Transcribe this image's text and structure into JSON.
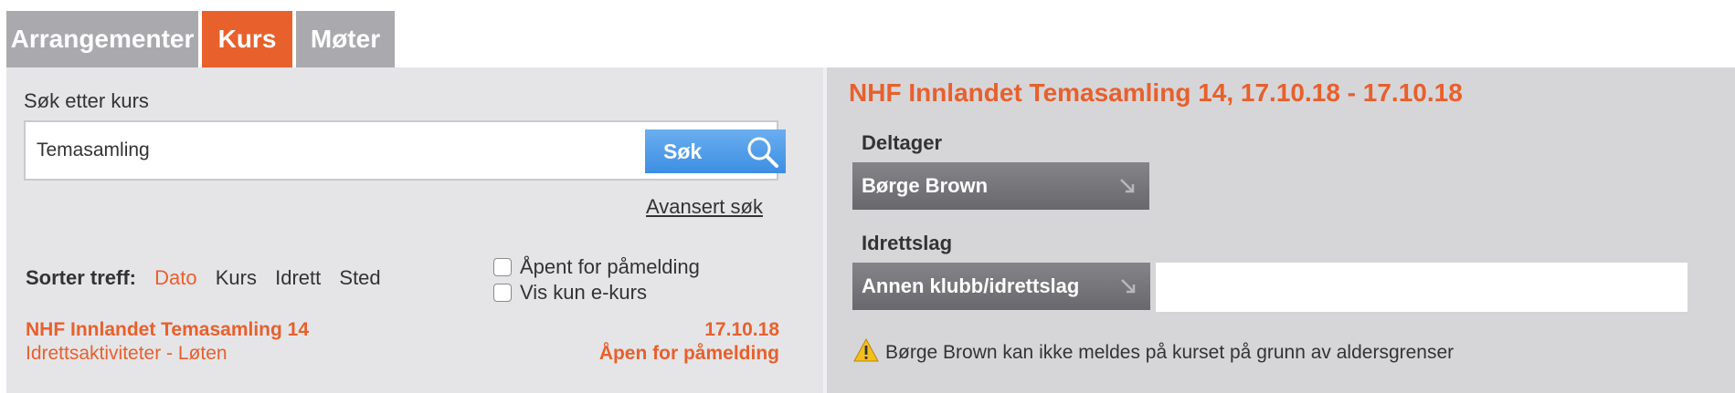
{
  "tabs": [
    {
      "label": "Arrangementer",
      "active": false
    },
    {
      "label": "Kurs",
      "active": true
    },
    {
      "label": "Møter",
      "active": false
    }
  ],
  "search": {
    "label": "Søk etter kurs",
    "value": "Temasamling",
    "button_label": "Søk",
    "advanced_link": "Avansert søk"
  },
  "sort": {
    "label": "Sorter treff:",
    "options": [
      "Dato",
      "Kurs",
      "Idrett",
      "Sted"
    ],
    "active": "Dato"
  },
  "filters": {
    "open_label": "Åpent for påmelding",
    "ecourse_label": "Vis kun e-kurs"
  },
  "result": {
    "title": "NHF Innlandet Temasamling 14",
    "subtitle": "Idrettsaktiviteter - Løten",
    "date": "17.10.18",
    "status": "Åpen for påmelding"
  },
  "detail": {
    "title": "NHF Innlandet Temasamling 14, 17.10.18 - 17.10.18",
    "participant_label": "Deltager",
    "participant_value": "Børge Brown",
    "club_label": "Idrettslag",
    "club_value": "Annen klubb/idrettslag",
    "warning": "Børge Brown kan ikke meldes på kurset på grunn av aldersgrenser"
  },
  "colors": {
    "accent": "#e8602c",
    "tab_inactive": "#a9a9ae",
    "search_button": "#3d8ee3",
    "left_panel_bg": "#e5e5e8",
    "right_panel_bg": "#d6d6d9",
    "dropdown_bg": "#76767b"
  },
  "icons": {
    "search": "search-icon",
    "dropdown_arrow": "arrow-down-right-icon",
    "warning": "warning-icon"
  }
}
